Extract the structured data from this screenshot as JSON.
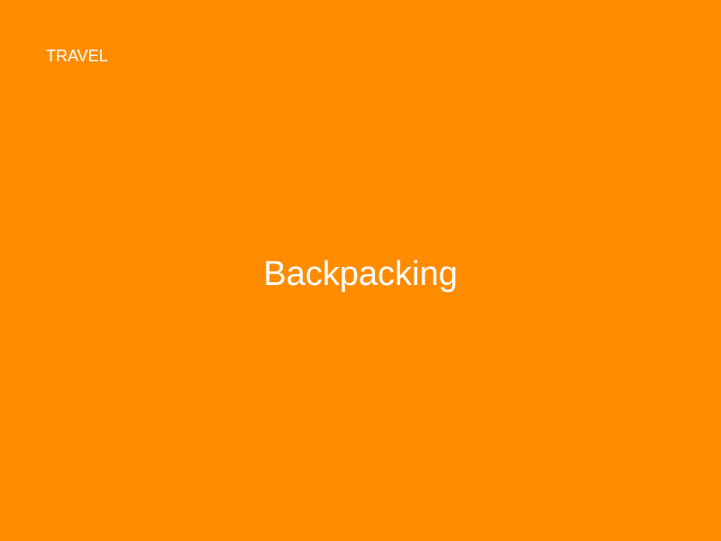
{
  "slide": {
    "category": "TRAVEL",
    "title": "Backpacking",
    "background_color": "#FF8C00",
    "text_color": "#FFFFFF"
  }
}
